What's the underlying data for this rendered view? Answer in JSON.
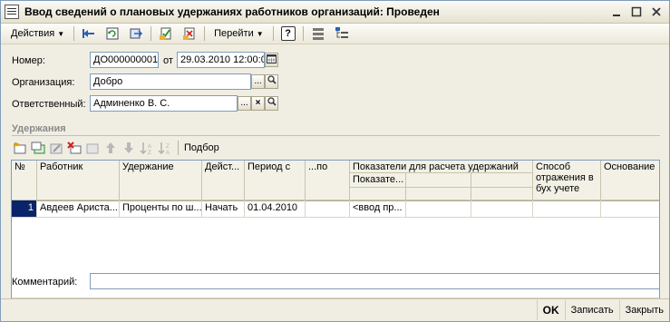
{
  "window": {
    "title": "Ввод сведений о плановых удержаниях работников организаций: Проведен"
  },
  "toolbar": {
    "actions_label": "Действия",
    "goto_label": "Перейти",
    "help_symbol": "?"
  },
  "form": {
    "number_label": "Номер:",
    "number_value": "ДО000000001",
    "date_prefix": "от",
    "date_value": "29.03.2010 12:00:0",
    "organization_label": "Организация:",
    "organization_value": "Добро",
    "responsible_label": "Ответственный:",
    "responsible_value": "Админенко В. С.",
    "select_symbol": "...",
    "clear_symbol": "×"
  },
  "section": {
    "title": "Удержания",
    "pick_label": "Подбор"
  },
  "table": {
    "headers": {
      "num": "№",
      "employee": "Работник",
      "deduction": "Удержание",
      "action": "Дейст...",
      "period_from": "Период с",
      "period_to": "...по",
      "indicators_group": "Показатели для расчета удержаний",
      "indicator_sub": "Показате...",
      "reflection": "Способ отражения в бух учете",
      "basis": "Основание"
    },
    "rows": [
      {
        "num": "1",
        "employee": "Авдеев Ариста...",
        "deduction": "Проценты по ш...",
        "action": "Начать",
        "period_from": "01.04.2010",
        "period_to": "",
        "indicator": "<ввод пр...",
        "reflection": "",
        "basis": ""
      }
    ]
  },
  "comment": {
    "label": "Комментарий:",
    "value": ""
  },
  "footer": {
    "ok_label": "OK",
    "save_label": "Записать",
    "close_label": "Закрыть"
  }
}
